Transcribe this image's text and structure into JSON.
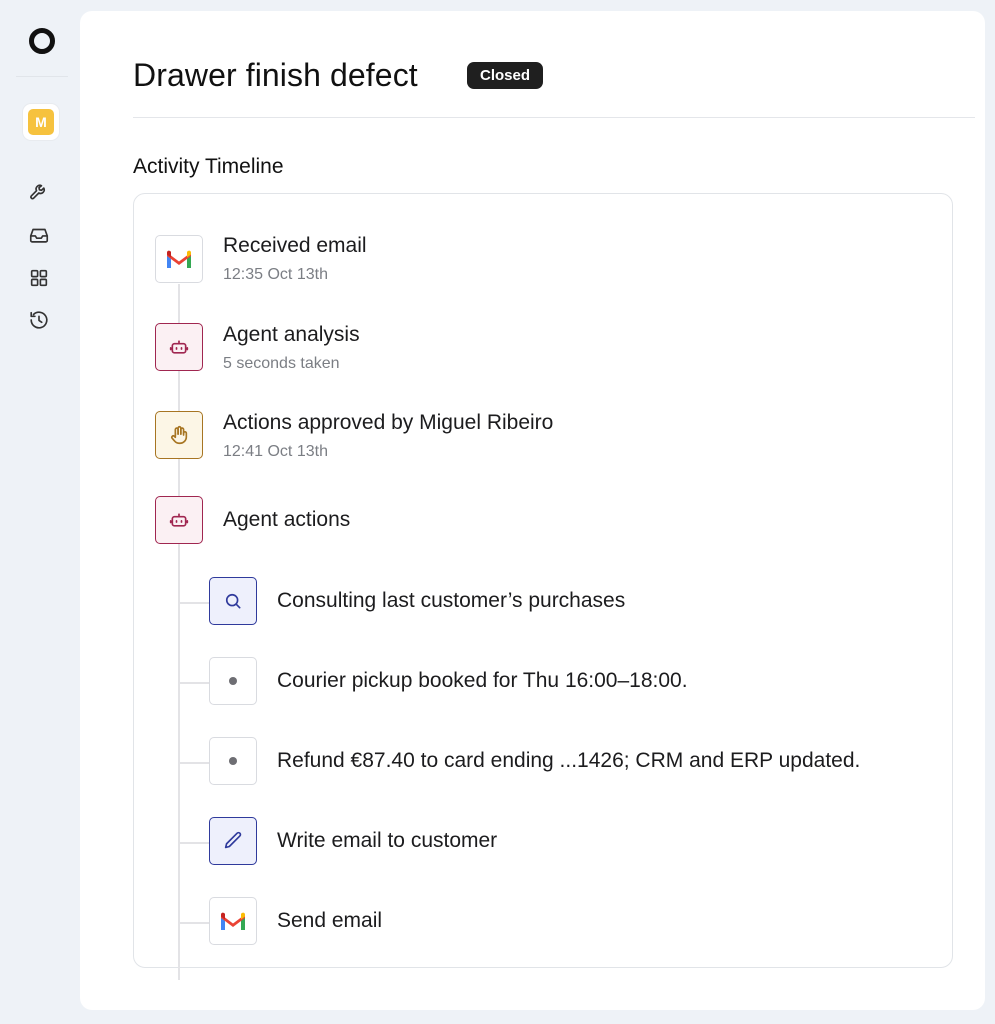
{
  "sidebar": {
    "avatar_initial": "M",
    "nav": [
      "wrench-icon",
      "inbox-icon",
      "grid-icon",
      "history-icon"
    ]
  },
  "header": {
    "title": "Drawer finish defect",
    "status": "Closed"
  },
  "timeline": {
    "heading": "Activity Timeline",
    "events": [
      {
        "title": "Received email",
        "subtitle": "12:35 Oct 13th",
        "icon": "gmail-icon"
      },
      {
        "title": "Agent analysis",
        "subtitle": "5 seconds taken",
        "icon": "robot-icon"
      },
      {
        "title": "Actions approved by Miguel Ribeiro",
        "subtitle": "12:41 Oct 13th",
        "icon": "hand-icon"
      },
      {
        "title": "Agent actions",
        "icon": "robot-icon"
      }
    ],
    "actions": [
      {
        "title": "Consulting last customer’s purchases",
        "icon": "search-icon"
      },
      {
        "title": "Courier pickup booked for Thu 16:00–18:00.",
        "icon": "dot-icon"
      },
      {
        "title": "Refund €87.40 to card ending ...1426; CRM and ERP updated.",
        "icon": "dot-icon"
      },
      {
        "title": "Write email to customer",
        "icon": "pencil-icon"
      },
      {
        "title": "Send email",
        "icon": "gmail-icon"
      }
    ]
  },
  "colors": {
    "agent": "#a02650",
    "approval": "#a77522",
    "tool": "#2f3a9c",
    "badge_bg": "#1f1f1f"
  }
}
